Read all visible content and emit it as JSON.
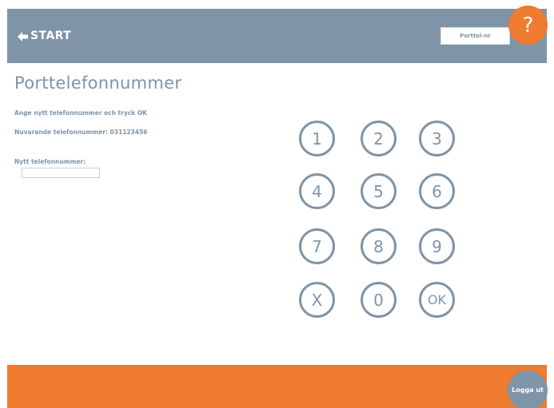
{
  "header": {
    "back_label": "START",
    "back_icon": "arrow-left-icon",
    "page_button_label": "Porttel-nr",
    "help_label": "?"
  },
  "main": {
    "title": "Porttelefonnummer",
    "instruction": "Ange nytt telefonnummer och tryck OK",
    "current_number_label": "Nuvarande telefonnummer:",
    "current_number_value": "031123456",
    "new_number_label": "Nytt telefonnummer:",
    "new_number_value": "",
    "new_number_placeholder": ""
  },
  "keypad": {
    "keys": [
      "1",
      "2",
      "3",
      "4",
      "5",
      "6",
      "7",
      "8",
      "9",
      "X",
      "0",
      "OK"
    ]
  },
  "footer": {
    "logout_label": "Logga ut"
  },
  "colors": {
    "header_background": "#7f94a6",
    "accent_orange": "#ee7b30",
    "text_gray": "#7f94a6",
    "background": "#ffffff"
  }
}
